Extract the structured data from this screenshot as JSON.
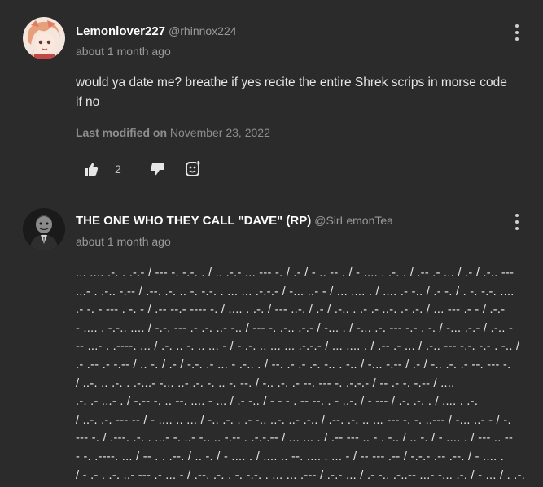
{
  "posts": [
    {
      "author_name": "Lemonlover227",
      "author_handle": "@rhinnox224",
      "time": "about 1 month ago",
      "body": "would ya date me? breathe if yes recite the entire Shrek scrips in morse code if no",
      "modified_label": "Last modified on",
      "modified_date": "November 23, 2022",
      "like_count": "2"
    },
    {
      "author_name": "THE ONE WHO THEY CALL \"DAVE\" (RP)",
      "author_handle": "@SirLemonTea",
      "time": "about 1 month ago",
      "morse_lines": [
        "... .... .-. . .-.- / --- -. -.-. . / .. .-.- ... --- -. / .- / - .. -- . / - .... . .-. . / .-- .- ... / .- / .-.. ---",
        "...- . .-.. -.-- / .--. .-. .. -. -.-. . ... ... .-.-.- / -... ..- - / ... .... . / .... .- -.. / .- -. / . -. -.-. ....",
        ".- -. - --- . -. - / .-- --.- ---- -. / .... . .-. / --- ..-. / .- / .-.. . .- .- ..-. .- .-. / ... --- .- - / .-.-",
        "- .... . -.-.. .... / -.-. --- .- .-. ..- -.. / --- -. .-.. .-.- / -... . / -... .-. --- -.- . -. / -... .-.- / .-.. -",
        "-- ...- . .----. ... / .-. .. -. .. ... - / - .-. .. ... ... .-.-.- / ... .... . / .-- .- ... / .-.. --- -.-. -.- . -.. /",
        ".- .-- .- -.-- / .. -. / .- / -.-. .- ... - .-.. . / --. .- .- .-. -.. . -.. / -... -.-- / .- / -.. .-. .- --. --- -.",
        "/ ..-. .. .-. . .-...- -... ..- .-. -. .. -. --. / -.. .-. .- --. --- -. .-.-.- / -- .- -. -.-- / ....",
        ".-. .- ...- . / -.-- -. .. --. .... - ... / .- -.. / - - - . -- --. . - ..-. / - --- / .-. .-. . / .... . .-.",
        "/ ..-. .-. --- -- / - .... .. ... / -.. .-. . .- -.. ..-. ..- .-.. / .--. .-. .. ... --- -. -. ..--- / -... ..- - / -.",
        "--- -. / .---. .-. . ...- -. ..- -.. .. -.-- . .-.-.-- / ... ... . / .-- --- .. - . -.. / .. -. / - .... . / --- .. --",
        "- -. .----. ... / -- . . .--. / .. -. / - .... . / .... .. --. .... . ... - / -- --- .-- / -.-.- .-- .--. / - .... .",
        "/ - .- . .-. ..- --- .- ... - / .--. .-. . -. -.-. . ... ... .--- / .-.- ... / .- -.. .-..-- ...- -... .-. / - ... / . .-. .- -.."
      ]
    }
  ],
  "icons": {
    "like": "thumbs-up-icon",
    "dislike": "thumbs-down-icon",
    "react": "emoji-reaction-icon",
    "menu": "more-vertical-icon"
  }
}
